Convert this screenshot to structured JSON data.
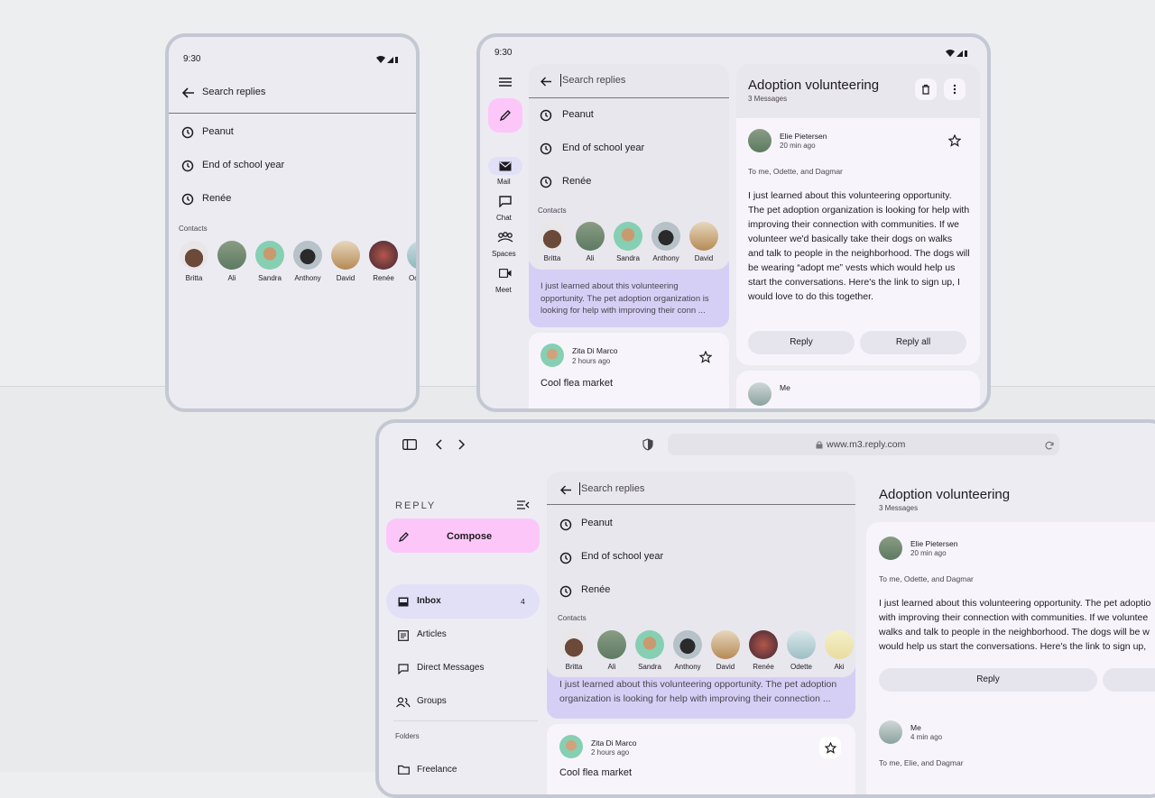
{
  "status": {
    "time": "9:30"
  },
  "search": {
    "placeholder": "Search replies"
  },
  "recent": [
    "Peanut",
    "End of school year",
    "Renée"
  ],
  "contacts_label": "Contacts",
  "contacts": [
    "Britta",
    "Ali",
    "Sandra",
    "Anthony",
    "David",
    "Renée",
    "Odette",
    "Aki"
  ],
  "phone_partial_contact": "Oc",
  "tablet_rail": {
    "mail": "Mail",
    "chat": "Chat",
    "spaces": "Spaces",
    "meet": "Meet"
  },
  "selected_email": {
    "snippet": "I just learned about this volunteering opportunity. The pet adoption organization is looking for help with improving their conn ...",
    "snippet_desktop": "I just learned about this volunteering opportunity. The pet adoption organization is looking for help with improving their connection ..."
  },
  "second_email": {
    "sender": "Zita Di Marco",
    "time": "2 hours ago",
    "subject": "Cool flea market"
  },
  "detail": {
    "title": "Adoption volunteering",
    "count": "3 Messages",
    "sender": "Elie Pietersen",
    "time": "20 min ago",
    "recipients": "To me, Odette, and Dagmar",
    "body": "I just learned about this volunteering opportunity. The pet adoption organization is looking for help with improving their connection with communities. If we volunteer we'd basically take their dogs on walks and talk to people in the neighborhood. The dogs will be wearing “adopt me” vests which would help us start the conversations. Here's the link to sign up, I would love to do this together.",
    "body_desktop_lines": [
      "I just learned about this volunteering opportunity. The pet adoptio",
      "with improving their connection with communities. If we voluntee",
      "walks and talk to people in the neighborhood. The dogs will be w",
      "would help us start the conversations. Here's the link to sign up,"
    ],
    "reply": "Reply",
    "reply_all": "Reply all",
    "second_sender": "Me",
    "second_time": "4 min ago",
    "second_recipients": "To me, Elie, and Dagmar",
    "tablet_second_sender": "Me"
  },
  "browser": {
    "url": "www.m3.reply.com"
  },
  "desktop_nav": {
    "brand": "REPLY",
    "compose": "Compose",
    "inbox": "Inbox",
    "inbox_count": "4",
    "articles": "Articles",
    "direct": "Direct Messages",
    "groups": "Groups",
    "folders": "Folders",
    "freelance": "Freelance"
  },
  "colors": {
    "background": "#eceef0",
    "surface": "#ecebf2",
    "card": "#f7f5fb",
    "compose": "#fcc7f8",
    "selected": "#d6cff5",
    "nav_active": "#e1e0f7"
  }
}
